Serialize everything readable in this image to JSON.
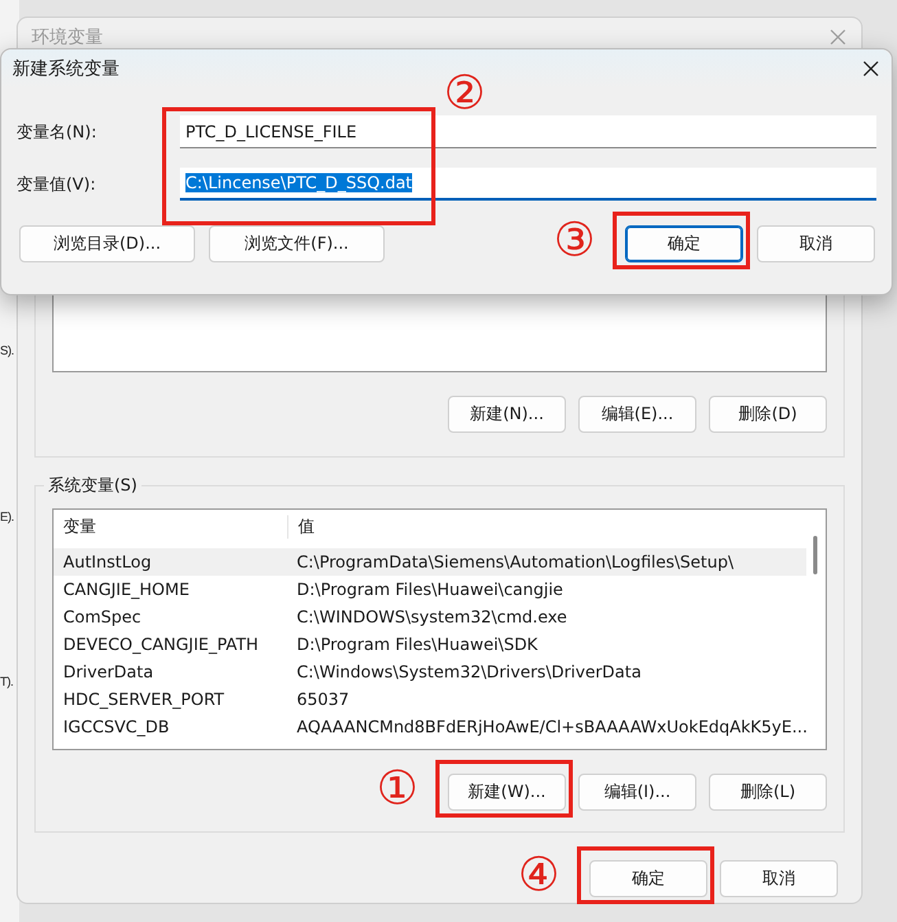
{
  "background_fragments": [
    "S).",
    "E).",
    "T)."
  ],
  "env_window": {
    "title": "环境变量",
    "user_buttons": [
      {
        "label": "新建(N)..."
      },
      {
        "label": "编辑(E)..."
      },
      {
        "label": "删除(D)"
      }
    ],
    "system_group_label": "系统变量(S)",
    "system_table": {
      "columns": [
        "变量",
        "值"
      ],
      "rows": [
        {
          "name": "AutInstLog",
          "value": "C:\\ProgramData\\Siemens\\Automation\\Logfiles\\Setup\\",
          "selected": true
        },
        {
          "name": "CANGJIE_HOME",
          "value": "D:\\Program Files\\Huawei\\cangjie",
          "selected": false
        },
        {
          "name": "ComSpec",
          "value": "C:\\WINDOWS\\system32\\cmd.exe",
          "selected": false
        },
        {
          "name": "DEVECO_CANGJIE_PATH",
          "value": "D:\\Program Files\\Huawei\\SDK",
          "selected": false
        },
        {
          "name": "DriverData",
          "value": "C:\\Windows\\System32\\Drivers\\DriverData",
          "selected": false
        },
        {
          "name": "HDC_SERVER_PORT",
          "value": "65037",
          "selected": false
        },
        {
          "name": "IGCCSVC_DB",
          "value": "AQAAANCMnd8BFdERjHoAwE/Cl+sBAAAAWxUokEdqAkK5yE...",
          "selected": false
        }
      ]
    },
    "system_buttons": [
      {
        "label": "新建(W)...",
        "annotation": "①"
      },
      {
        "label": "编辑(I)..."
      },
      {
        "label": "删除(L)"
      }
    ],
    "footer_buttons": [
      {
        "label": "确定",
        "annotation": "④"
      },
      {
        "label": "取消"
      }
    ]
  },
  "dialog": {
    "title": "新建系统变量",
    "annotation": "②",
    "fields": [
      {
        "label": "变量名(N):",
        "value": "PTC_D_LICENSE_FILE",
        "focused": false
      },
      {
        "label": "变量值(V):",
        "value": "C:\\Lincense\\PTC_D_SSQ.dat",
        "focused": true
      }
    ],
    "left_buttons": [
      {
        "label": "浏览目录(D)..."
      },
      {
        "label": "浏览文件(F)..."
      }
    ],
    "right_buttons": [
      {
        "label": "确定",
        "default": true,
        "annotation": "③"
      },
      {
        "label": "取消",
        "default": false
      }
    ]
  }
}
